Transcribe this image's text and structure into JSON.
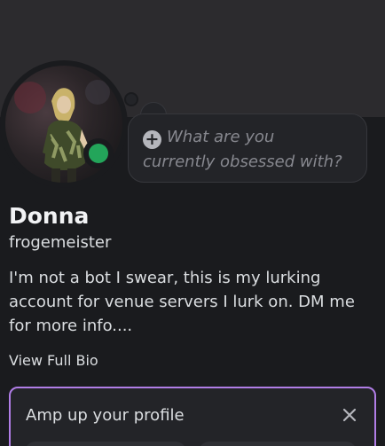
{
  "profile": {
    "display_name": "Donna",
    "username": "frogemeister",
    "bio": "I'm not a bot I swear, this is my lurking\naccount for venue servers I lurk on. DM me\nfor more info....",
    "view_full_bio": "View Full Bio",
    "status": "online"
  },
  "status_bubble": {
    "line1": "What are you",
    "line2": "currently obsessed with?"
  },
  "amp_card": {
    "title": "Amp up your profile"
  },
  "colors": {
    "online": "#23a55a",
    "accent_border": "#b07de6"
  }
}
